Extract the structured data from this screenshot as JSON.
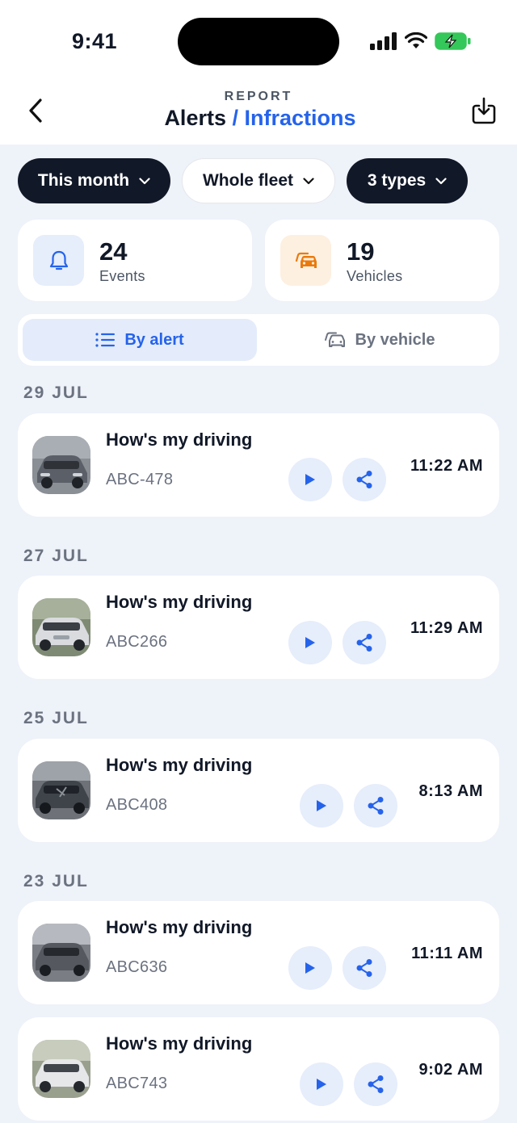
{
  "status_bar": {
    "time": "9:41"
  },
  "header": {
    "eyebrow": "REPORT",
    "title_main": "Alerts",
    "title_sep": "/",
    "title_highlight": "Infractions"
  },
  "filters": [
    {
      "label": "This month",
      "style": "dark"
    },
    {
      "label": "Whole fleet",
      "style": "light"
    },
    {
      "label": "3 types",
      "style": "dark"
    }
  ],
  "stats": {
    "events": {
      "value": "24",
      "label": "Events",
      "icon": "bell-icon"
    },
    "vehicles": {
      "value": "19",
      "label": "Vehicles",
      "icon": "car-icon"
    }
  },
  "view_toggle": {
    "by_alert": "By alert",
    "by_vehicle": "By vehicle",
    "selected": "by_alert"
  },
  "groups": [
    {
      "date": "29 JUL",
      "items": [
        {
          "title": "How's my driving",
          "plate": "ABC-478",
          "time": "11:22 AM",
          "thumb_color": "#6b7280"
        }
      ]
    },
    {
      "date": "27 JUL",
      "items": [
        {
          "title": "How's my driving",
          "plate": "ABC266",
          "time": "11:29 AM",
          "thumb_color": "#c9ccd1"
        }
      ]
    },
    {
      "date": "25 JUL",
      "items": [
        {
          "title": "How's my driving",
          "plate": "ABC408",
          "time": "8:13 AM",
          "thumb_color": "#4b4f56"
        }
      ]
    },
    {
      "date": "23 JUL",
      "items": [
        {
          "title": "How's my driving",
          "plate": "ABC636",
          "time": "11:11 AM",
          "thumb_color": "#5a5e66"
        },
        {
          "title": "How's my driving",
          "plate": "ABC743",
          "time": "9:02 AM",
          "thumb_color": "#d6d8db"
        }
      ]
    }
  ],
  "colors": {
    "accent": "#2563eb",
    "dark_chip": "#111827",
    "background": "#eef2f9",
    "battery": "#34c759"
  }
}
